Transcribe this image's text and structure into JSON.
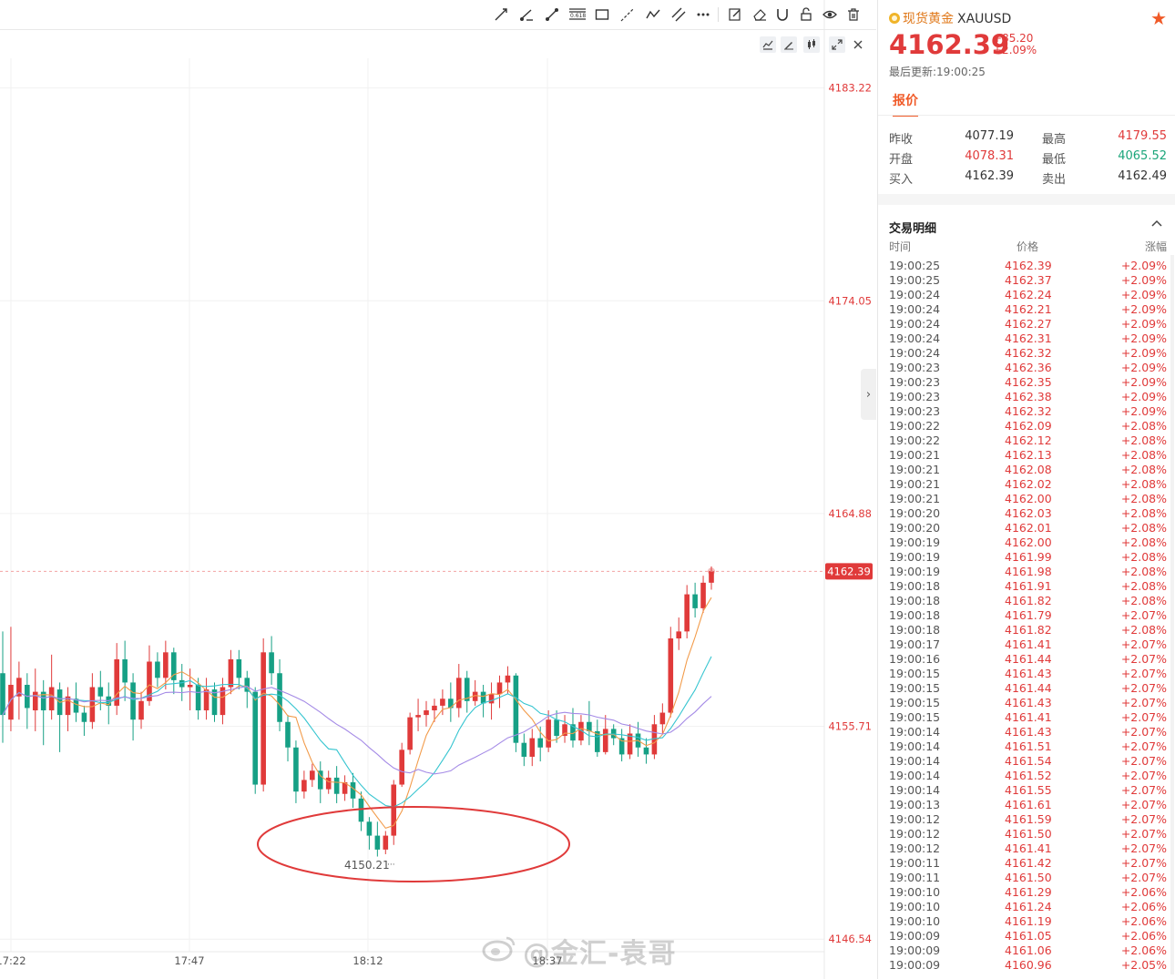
{
  "toolbar": {
    "tools": [
      "trend-line-icon",
      "ray-line-icon",
      "segment-icon",
      "fibonacci-icon",
      "rectangle-icon",
      "extended-line-icon",
      "polyline-icon",
      "parallel-channel-icon",
      "more-icon",
      "edit-icon",
      "eraser-icon",
      "magnet-icon",
      "unlock-icon",
      "eye-icon",
      "trash-icon"
    ],
    "fib_label": "0.618"
  },
  "chart": {
    "price_axis": [
      "4183.22",
      "4174.05",
      "4164.88",
      "4155.71",
      "4146.54"
    ],
    "current_price": "4162.39",
    "time_axis": [
      "17:22",
      "17:47",
      "18:12",
      "18:37"
    ],
    "low_label": "4150.21",
    "colors": {
      "up": "#e03a3a",
      "down": "#16a085",
      "ma_orange": "#f29b4a",
      "ma_cyan": "#36c5d0",
      "ma_purple": "#a48ae6",
      "circle": "#e03a3a"
    }
  },
  "chart_data": {
    "type": "candlestick",
    "ylim": [
      4146.0,
      4184.5
    ],
    "candles": [
      [
        4158.0,
        4156.2,
        4155.0,
        4159.8
      ],
      [
        4156.0,
        4157.5,
        4155.5,
        4160.0
      ],
      [
        4157.0,
        4157.8,
        4156.0,
        4158.5
      ],
      [
        4157.5,
        4156.5,
        4155.6,
        4158.0
      ],
      [
        4156.4,
        4157.2,
        4155.5,
        4158.2
      ],
      [
        4157.2,
        4156.4,
        4154.9,
        4157.7
      ],
      [
        4156.4,
        4157.4,
        4156.0,
        4158.8
      ],
      [
        4157.3,
        4156.2,
        4154.6,
        4157.6
      ],
      [
        4156.2,
        4157.0,
        4155.5,
        4157.4
      ],
      [
        4156.9,
        4156.3,
        4155.9,
        4157.6
      ],
      [
        4156.3,
        4155.9,
        4155.3,
        4156.6
      ],
      [
        4155.9,
        4157.4,
        4155.6,
        4158.0
      ],
      [
        4157.4,
        4157.0,
        4156.4,
        4158.1
      ],
      [
        4157.0,
        4156.6,
        4155.8,
        4157.6
      ],
      [
        4156.6,
        4158.6,
        4156.2,
        4159.3
      ],
      [
        4158.6,
        4157.6,
        4156.8,
        4159.4
      ],
      [
        4157.6,
        4156.0,
        4155.1,
        4158.0
      ],
      [
        4156.0,
        4156.8,
        4155.6,
        4157.2
      ],
      [
        4156.8,
        4158.5,
        4156.6,
        4159.2
      ],
      [
        4158.5,
        4157.8,
        4157.4,
        4158.9
      ],
      [
        4157.8,
        4158.9,
        4157.3,
        4159.4
      ],
      [
        4158.9,
        4157.7,
        4157.1,
        4159.1
      ],
      [
        4157.7,
        4157.4,
        4156.8,
        4158.4
      ],
      [
        4157.4,
        4157.5,
        4156.4,
        4158.2
      ],
      [
        4157.5,
        4156.4,
        4156.0,
        4157.8
      ],
      [
        4156.4,
        4157.3,
        4156.0,
        4157.8
      ],
      [
        4157.3,
        4156.2,
        4155.9,
        4157.6
      ],
      [
        4156.2,
        4157.4,
        4155.8,
        4157.8
      ],
      [
        4157.4,
        4158.6,
        4157.1,
        4159.0
      ],
      [
        4158.6,
        4157.8,
        4157.3,
        4159.0
      ],
      [
        4157.8,
        4157.2,
        4156.5,
        4158.1
      ],
      [
        4157.2,
        4153.2,
        4152.8,
        4157.4
      ],
      [
        4153.2,
        4158.9,
        4152.9,
        4159.5
      ],
      [
        4158.9,
        4158.0,
        4157.5,
        4159.6
      ],
      [
        4158.0,
        4155.9,
        4155.5,
        4158.6
      ],
      [
        4155.9,
        4154.8,
        4154.2,
        4156.2
      ],
      [
        4154.8,
        4152.9,
        4152.4,
        4155.1
      ],
      [
        4152.9,
        4153.4,
        4152.6,
        4153.8
      ],
      [
        4153.4,
        4153.8,
        4153.1,
        4154.1
      ],
      [
        4153.8,
        4153.0,
        4152.4,
        4154.2
      ],
      [
        4153.0,
        4153.5,
        4152.8,
        4153.8
      ],
      [
        4153.5,
        4152.8,
        4152.4,
        4154.0
      ],
      [
        4152.8,
        4153.3,
        4152.5,
        4153.6
      ],
      [
        4153.3,
        4152.6,
        4152.2,
        4153.7
      ],
      [
        4152.6,
        4151.6,
        4151.2,
        4152.9
      ],
      [
        4151.6,
        4151.0,
        4150.4,
        4151.8
      ],
      [
        4151.0,
        4150.4,
        4150.1,
        4151.6
      ],
      [
        4150.4,
        4151.0,
        4150.2,
        4151.2
      ],
      [
        4151.0,
        4153.2,
        4150.6,
        4153.4
      ],
      [
        4153.2,
        4154.7,
        4153.1,
        4155.0
      ],
      [
        4154.7,
        4156.1,
        4154.5,
        4156.3
      ],
      [
        4156.1,
        4156.2,
        4155.5,
        4156.9
      ],
      [
        4156.2,
        4156.4,
        4155.7,
        4156.8
      ],
      [
        4156.4,
        4156.6,
        4155.9,
        4156.9
      ],
      [
        4156.6,
        4156.9,
        4156.2,
        4157.3
      ],
      [
        4156.9,
        4156.5,
        4155.9,
        4157.6
      ],
      [
        4156.5,
        4157.8,
        4156.1,
        4158.4
      ],
      [
        4157.8,
        4156.8,
        4156.3,
        4158.1
      ],
      [
        4156.8,
        4157.2,
        4156.6,
        4157.7
      ],
      [
        4157.2,
        4156.7,
        4156.1,
        4157.5
      ],
      [
        4156.7,
        4157.1,
        4156.0,
        4157.6
      ],
      [
        4157.1,
        4157.6,
        4156.5,
        4157.9
      ],
      [
        4157.6,
        4157.9,
        4157.1,
        4158.3
      ],
      [
        4157.9,
        4155.0,
        4154.6,
        4158.0
      ],
      [
        4155.0,
        4154.4,
        4154.0,
        4155.4
      ],
      [
        4154.4,
        4155.2,
        4154.0,
        4155.6
      ],
      [
        4155.2,
        4154.8,
        4154.2,
        4155.7
      ],
      [
        4154.8,
        4156.0,
        4154.6,
        4156.4
      ],
      [
        4156.0,
        4155.3,
        4155.0,
        4156.4
      ],
      [
        4155.3,
        4155.8,
        4155.0,
        4156.2
      ],
      [
        4155.8,
        4155.1,
        4154.8,
        4156.5
      ],
      [
        4155.1,
        4155.9,
        4154.9,
        4156.2
      ],
      [
        4155.9,
        4155.5,
        4154.9,
        4156.8
      ],
      [
        4155.5,
        4154.6,
        4154.4,
        4156.0
      ],
      [
        4154.6,
        4155.6,
        4154.5,
        4156.2
      ],
      [
        4155.6,
        4155.2,
        4154.9,
        4155.8
      ],
      [
        4155.2,
        4154.5,
        4154.2,
        4155.6
      ],
      [
        4154.5,
        4155.4,
        4154.3,
        4155.8
      ],
      [
        4155.4,
        4154.8,
        4154.4,
        4155.9
      ],
      [
        4154.8,
        4154.5,
        4154.1,
        4155.2
      ],
      [
        4154.5,
        4155.8,
        4154.3,
        4156.2
      ],
      [
        4155.8,
        4156.3,
        4155.4,
        4156.7
      ],
      [
        4156.3,
        4159.5,
        4156.1,
        4160.0
      ],
      [
        4159.5,
        4159.8,
        4159.0,
        4160.4
      ],
      [
        4159.8,
        4161.4,
        4159.5,
        4161.8
      ],
      [
        4161.4,
        4160.8,
        4160.4,
        4161.9
      ],
      [
        4160.8,
        4161.9,
        4160.6,
        4162.2
      ],
      [
        4161.9,
        4162.4,
        4161.6,
        4162.6
      ]
    ]
  },
  "quote": {
    "name_cn": "现货黄金",
    "code": "XAUUSD",
    "price": "4162.39",
    "change": "+85.20",
    "change_pct": "+2.09%",
    "updated": "最后更新:19:00:25",
    "tab": "报价",
    "rows": [
      {
        "l1": "昨收",
        "v1": "4077.19",
        "l2": "最高",
        "v2": "4179.55"
      },
      {
        "l1": "开盘",
        "v1": "4078.31",
        "l2": "最低",
        "v2": "4065.52"
      },
      {
        "l1": "买入",
        "v1": "4162.39",
        "l2": "卖出",
        "v2": "4162.49"
      }
    ]
  },
  "trades": {
    "title": "交易明细",
    "headers": {
      "time": "时间",
      "price": "价格",
      "change": "涨幅"
    },
    "rows": [
      [
        "19:00:25",
        "4162.39",
        "+2.09%"
      ],
      [
        "19:00:25",
        "4162.37",
        "+2.09%"
      ],
      [
        "19:00:24",
        "4162.24",
        "+2.09%"
      ],
      [
        "19:00:24",
        "4162.21",
        "+2.09%"
      ],
      [
        "19:00:24",
        "4162.27",
        "+2.09%"
      ],
      [
        "19:00:24",
        "4162.31",
        "+2.09%"
      ],
      [
        "19:00:24",
        "4162.32",
        "+2.09%"
      ],
      [
        "19:00:23",
        "4162.36",
        "+2.09%"
      ],
      [
        "19:00:23",
        "4162.35",
        "+2.09%"
      ],
      [
        "19:00:23",
        "4162.38",
        "+2.09%"
      ],
      [
        "19:00:23",
        "4162.32",
        "+2.09%"
      ],
      [
        "19:00:22",
        "4162.09",
        "+2.08%"
      ],
      [
        "19:00:22",
        "4162.12",
        "+2.08%"
      ],
      [
        "19:00:21",
        "4162.13",
        "+2.08%"
      ],
      [
        "19:00:21",
        "4162.08",
        "+2.08%"
      ],
      [
        "19:00:21",
        "4162.02",
        "+2.08%"
      ],
      [
        "19:00:21",
        "4162.00",
        "+2.08%"
      ],
      [
        "19:00:20",
        "4162.03",
        "+2.08%"
      ],
      [
        "19:00:20",
        "4162.01",
        "+2.08%"
      ],
      [
        "19:00:19",
        "4162.00",
        "+2.08%"
      ],
      [
        "19:00:19",
        "4161.99",
        "+2.08%"
      ],
      [
        "19:00:19",
        "4161.98",
        "+2.08%"
      ],
      [
        "19:00:18",
        "4161.91",
        "+2.08%"
      ],
      [
        "19:00:18",
        "4161.82",
        "+2.08%"
      ],
      [
        "19:00:18",
        "4161.79",
        "+2.07%"
      ],
      [
        "19:00:18",
        "4161.82",
        "+2.08%"
      ],
      [
        "19:00:17",
        "4161.41",
        "+2.07%"
      ],
      [
        "19:00:16",
        "4161.44",
        "+2.07%"
      ],
      [
        "19:00:15",
        "4161.43",
        "+2.07%"
      ],
      [
        "19:00:15",
        "4161.44",
        "+2.07%"
      ],
      [
        "19:00:15",
        "4161.43",
        "+2.07%"
      ],
      [
        "19:00:15",
        "4161.41",
        "+2.07%"
      ],
      [
        "19:00:14",
        "4161.43",
        "+2.07%"
      ],
      [
        "19:00:14",
        "4161.51",
        "+2.07%"
      ],
      [
        "19:00:14",
        "4161.54",
        "+2.07%"
      ],
      [
        "19:00:14",
        "4161.52",
        "+2.07%"
      ],
      [
        "19:00:14",
        "4161.55",
        "+2.07%"
      ],
      [
        "19:00:13",
        "4161.61",
        "+2.07%"
      ],
      [
        "19:00:12",
        "4161.59",
        "+2.07%"
      ],
      [
        "19:00:12",
        "4161.50",
        "+2.07%"
      ],
      [
        "19:00:12",
        "4161.41",
        "+2.07%"
      ],
      [
        "19:00:11",
        "4161.42",
        "+2.07%"
      ],
      [
        "19:00:11",
        "4161.50",
        "+2.07%"
      ],
      [
        "19:00:10",
        "4161.29",
        "+2.06%"
      ],
      [
        "19:00:10",
        "4161.24",
        "+2.06%"
      ],
      [
        "19:00:10",
        "4161.19",
        "+2.06%"
      ],
      [
        "19:00:09",
        "4161.05",
        "+2.06%"
      ],
      [
        "19:00:09",
        "4161.06",
        "+2.06%"
      ],
      [
        "19:00:09",
        "4160.96",
        "+2.05%"
      ]
    ]
  },
  "watermark": "@金汇-袁哥"
}
